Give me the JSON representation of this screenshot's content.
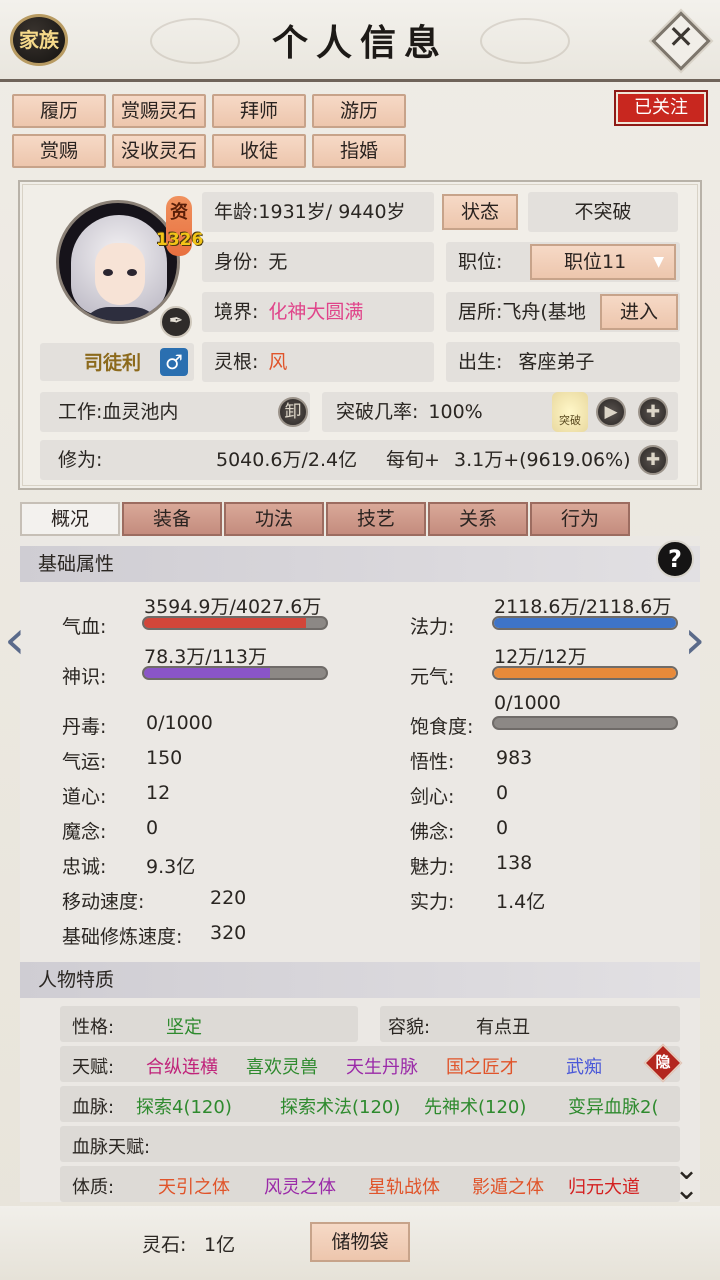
{
  "header": {
    "title": "个人信息",
    "clan_label": "家族",
    "close_icon": "close-icon"
  },
  "top_buttons": [
    [
      "履历",
      "赏赐灵石",
      "拜师",
      "游历"
    ],
    [
      "赏赐",
      "没收灵石",
      "收徒",
      "指婚"
    ]
  ],
  "follow_label": "已关注",
  "character": {
    "name": "司徒利",
    "aptitude_label": "资",
    "aptitude_value": "1326",
    "age_label": "年龄:",
    "age_value": "1931岁/ 9440岁",
    "status_btn": "状态",
    "breakthrough_state": "不突破",
    "identity_label": "身份:",
    "identity_value": "无",
    "position_label": "职位:",
    "position_value": "职位11",
    "realm_label": "境界:",
    "realm_value": "化神大圆满",
    "residence_label": "居所:",
    "residence_value": "飞舟(基地",
    "enter_btn": "进入",
    "root_label": "灵根:",
    "root_value": "风",
    "birth_label": "出生:",
    "birth_value": "客座弟子",
    "work_label": "工作:",
    "work_value": "血灵池内",
    "unload_btn": "卸",
    "break_rate_label": "突破几率:",
    "break_rate_value": "100%",
    "break_icon_label": "突破",
    "cultivation_label": "修为:",
    "cultivation_value": "5040.6万/2.4亿",
    "per_round_label": "每旬+",
    "per_round_value": "3.1万+(9619.06%)"
  },
  "tabs": [
    "概况",
    "装备",
    "功法",
    "技艺",
    "关系",
    "行为"
  ],
  "basic_section": {
    "title": "基础属性",
    "help": "?",
    "hp": {
      "label": "气血:",
      "value": "3594.9万/4027.6万",
      "fraction": 0.8926,
      "color": "#d2463a"
    },
    "mana": {
      "label": "法力:",
      "value": "2118.6万/2118.6万",
      "fraction": 1.0,
      "color": "#3e74c8"
    },
    "sense": {
      "label": "神识:",
      "value": "78.3万/113万",
      "fraction": 0.693,
      "color": "#8a55c8"
    },
    "vigor": {
      "label": "元气:",
      "value": "12万/12万",
      "fraction": 1.0,
      "color": "#e88a3a"
    },
    "satiety": {
      "label": "饱食度:",
      "value": "0/1000",
      "fraction": 0.0
    },
    "left_stats": [
      {
        "label": "丹毒:",
        "value": "0/1000"
      },
      {
        "label": "气运:",
        "value": "150"
      },
      {
        "label": "道心:",
        "value": "12"
      },
      {
        "label": "魔念:",
        "value": "0"
      },
      {
        "label": "忠诚:",
        "value": "9.3亿"
      },
      {
        "label": "移动速度:",
        "value": "220"
      },
      {
        "label": "基础修炼速度:",
        "value": "320"
      }
    ],
    "right_stats": [
      {
        "label": "悟性:",
        "value": "983"
      },
      {
        "label": "剑心:",
        "value": "0"
      },
      {
        "label": "佛念:",
        "value": "0"
      },
      {
        "label": "魅力:",
        "value": "138"
      },
      {
        "label": "实力:",
        "value": "1.4亿"
      }
    ]
  },
  "traits_section": {
    "title": "人物特质",
    "personality_label": "性格:",
    "personality_value": "坚定",
    "looks_label": "容貌:",
    "looks_value": "有点丑",
    "talent_label": "天赋:",
    "talents": [
      {
        "text": "合纵连横",
        "color": "#c0237a"
      },
      {
        "text": "喜欢灵兽",
        "color": "#2e8a2e"
      },
      {
        "text": "天生丹脉",
        "color": "#9a2aa8"
      },
      {
        "text": "国之匠才",
        "color": "#e0542a"
      },
      {
        "text": "武痴",
        "color": "#4a58d8"
      }
    ],
    "hide_btn": "隐",
    "bloodline_label": "血脉:",
    "bloodlines": [
      {
        "text": "探索4(120)",
        "color": "#2e8a2e"
      },
      {
        "text": "探索术法(120)",
        "color": "#2e8a2e"
      },
      {
        "text": "先神术(120)",
        "color": "#2e8a2e"
      },
      {
        "text": "变异血脉2(",
        "color": "#2e8a2e"
      }
    ],
    "bloodline_talent_label": "血脉天赋:",
    "physique_label": "体质:",
    "physiques": [
      {
        "text": "天引之体",
        "color": "#e0542a"
      },
      {
        "text": "风灵之体",
        "color": "#9a2aa8"
      },
      {
        "text": "星轨战体",
        "color": "#e0542a"
      },
      {
        "text": "影遁之体",
        "color": "#e0542a"
      },
      {
        "text": "归元大道",
        "color": "#d42020"
      }
    ]
  },
  "footer": {
    "spirit_stone_label": "灵石:",
    "spirit_stone_value": "1亿",
    "storage_btn": "储物袋"
  }
}
